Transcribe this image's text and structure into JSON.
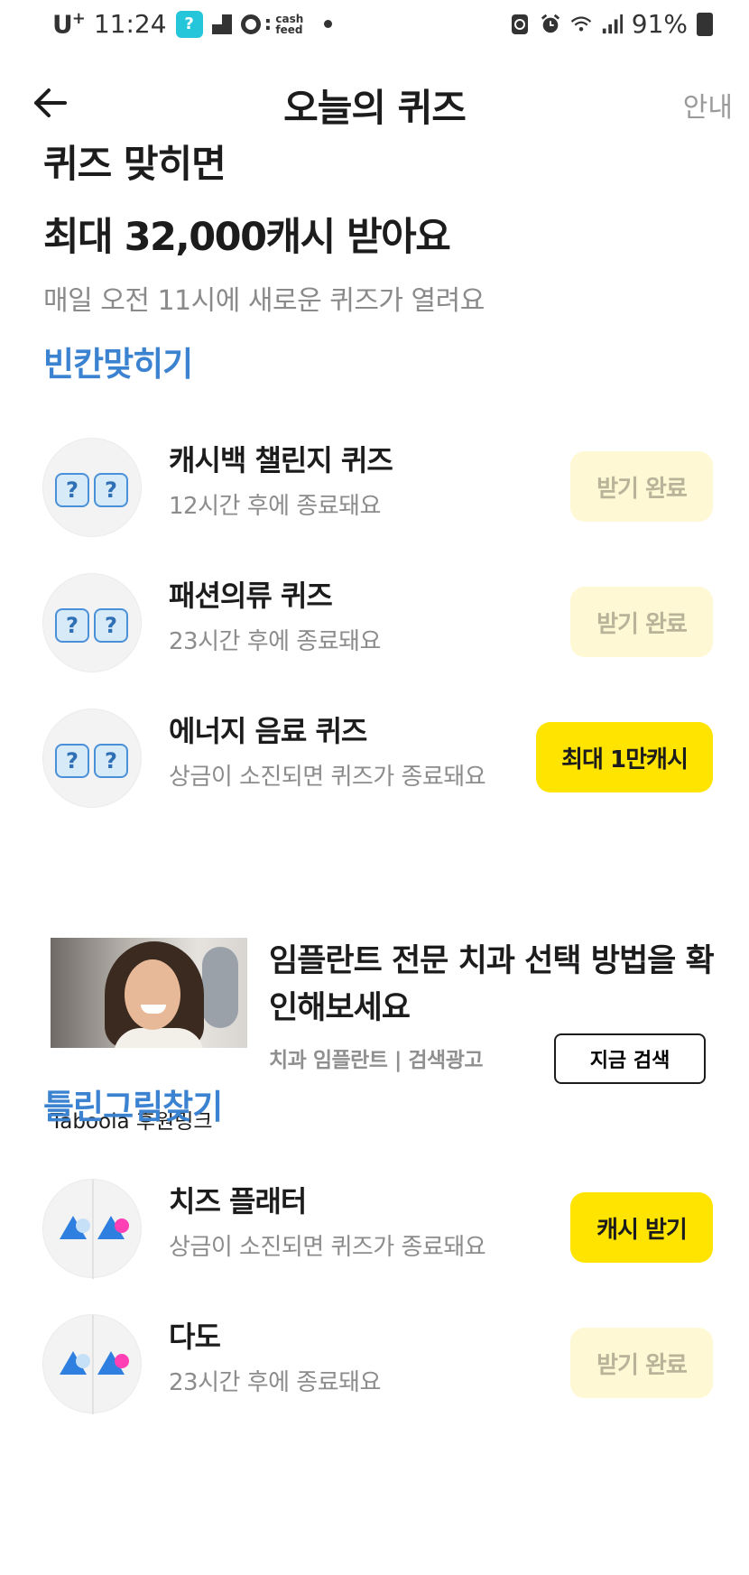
{
  "status_bar": {
    "carrier": "U",
    "carrier_sup": "+",
    "time": "11:24",
    "app_icon_glyph": "?",
    "cashfeed_text": "cash feed",
    "battery": "91%"
  },
  "header": {
    "title": "오늘의 퀴즈",
    "guide": "안내"
  },
  "hero": {
    "line1": "퀴즈 맞히면",
    "line2": "최대 32,000캐시 받아요",
    "subtitle": "매일 오전 11시에 새로운 퀴즈가 열려요"
  },
  "sections": {
    "fill_blank": "빈칸맞히기",
    "spot_difference": "틀린그림찾기"
  },
  "fill_blank_quizzes": [
    {
      "title": "캐시백 챌린지 퀴즈",
      "subtitle": "12시간 후에 종료돼요",
      "button": "받기 완료"
    },
    {
      "title": "패션의류 퀴즈",
      "subtitle": "23시간 후에 종료돼요",
      "button": "받기 완료"
    },
    {
      "title": "에너지 음료 퀴즈",
      "subtitle": "상금이 소진되면 퀴즈가 종료돼요",
      "button": "최대 1만캐시"
    }
  ],
  "ad": {
    "title": "임플란트 전문 치과 선택 방법을 확인해보세요",
    "source": "치과 임플란트 | 검색광고",
    "button": "지금 검색",
    "sponsor": "Taboola 후원링크"
  },
  "spot_quizzes": [
    {
      "title": "치즈 플래터",
      "subtitle": "상금이 소진되면 퀴즈가 종료돼요",
      "button": "캐시 받기"
    },
    {
      "title": "다도",
      "subtitle": "23시간 후에 종료돼요",
      "button": "받기 완료"
    }
  ],
  "colors": {
    "accent_blue": "#3b82d0",
    "button_yellow": "#ffe400",
    "done_bg": "#fff8d4",
    "done_text": "#b9b39a"
  },
  "icons": {
    "back": "arrow-left-icon",
    "quiz": "question-boxes-icon",
    "spot": "triangles-icon"
  }
}
